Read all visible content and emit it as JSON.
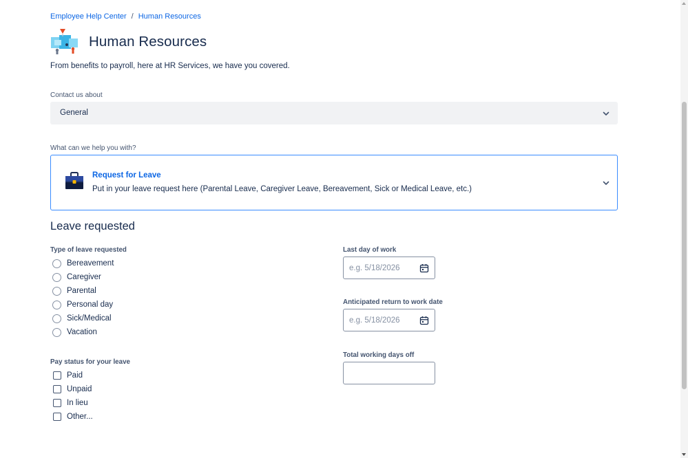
{
  "breadcrumb": {
    "items": [
      "Employee Help Center",
      "Human Resources"
    ],
    "separator": "/"
  },
  "portal": {
    "title": "Human Resources",
    "description": "From benefits to payroll, here at HR Services, we have you covered.",
    "logo_icon": "portal-illustration-icon"
  },
  "contact": {
    "label": "Contact us about",
    "value": "General",
    "icon": "chevron-down-icon"
  },
  "request_type": {
    "label": "What can we help you with?",
    "name": "Request for Leave",
    "description": "Put in your leave request here (Parental Leave, Caregiver Leave, Bereavement, Sick or Medical Leave, etc.)",
    "icon": "briefcase-icon"
  },
  "leave": {
    "section_title": "Leave requested",
    "type_label": "Type of leave requested",
    "types": [
      "Bereavement",
      "Caregiver",
      "Parental",
      "Personal day",
      "Sick/Medical",
      "Vacation"
    ],
    "pay_label": "Pay status for your leave",
    "pay_options": [
      "Paid",
      "Unpaid",
      "In lieu",
      "Other..."
    ],
    "last_day_label": "Last day of work",
    "last_day_placeholder": "e.g. 5/18/2026",
    "return_label": "Anticipated return to work date",
    "return_placeholder": "e.g. 5/18/2026",
    "days_off_label": "Total working days off",
    "days_off_value": ""
  },
  "colors": {
    "link": "#0c66e4",
    "text": "#172b4d",
    "subtle": "#44546f",
    "focus_border": "#388bff",
    "select_bg": "#f1f2f4"
  }
}
